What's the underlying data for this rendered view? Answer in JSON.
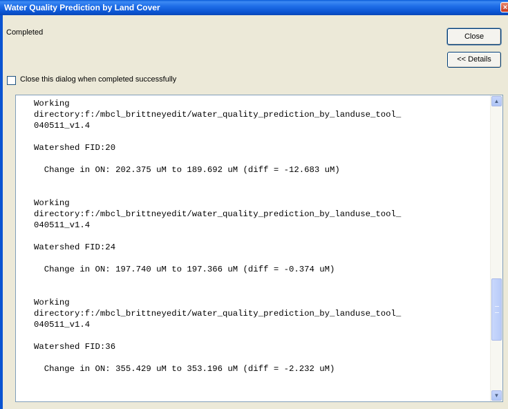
{
  "window": {
    "title": "Water Quality Prediction by Land Cover",
    "close_glyph": "×"
  },
  "status": "Completed",
  "buttons": {
    "close": "Close",
    "details": "<< Details"
  },
  "checkbox": {
    "label": "Close this dialog when completed successfully",
    "checked": false
  },
  "log_lines": [
    "Working",
    "directory:f:/mbcl_brittneyedit/water_quality_prediction_by_landuse_tool_",
    "040511_v1.4",
    "",
    "Watershed FID:20",
    "",
    "  Change in ON: 202.375 uM to 189.692 uM (diff = -12.683 uM)",
    "",
    "",
    "Working",
    "directory:f:/mbcl_brittneyedit/water_quality_prediction_by_landuse_tool_",
    "040511_v1.4",
    "",
    "Watershed FID:24",
    "",
    "  Change in ON: 197.740 uM to 197.366 uM (diff = -0.374 uM)",
    "",
    "",
    "Working",
    "directory:f:/mbcl_brittneyedit/water_quality_prediction_by_landuse_tool_",
    "040511_v1.4",
    "",
    "Watershed FID:36",
    "",
    "  Change in ON: 355.429 uM to 353.196 uM (diff = -2.232 uM)"
  ],
  "scrollbar": {
    "up_glyph": "▲",
    "down_glyph": "▼"
  }
}
